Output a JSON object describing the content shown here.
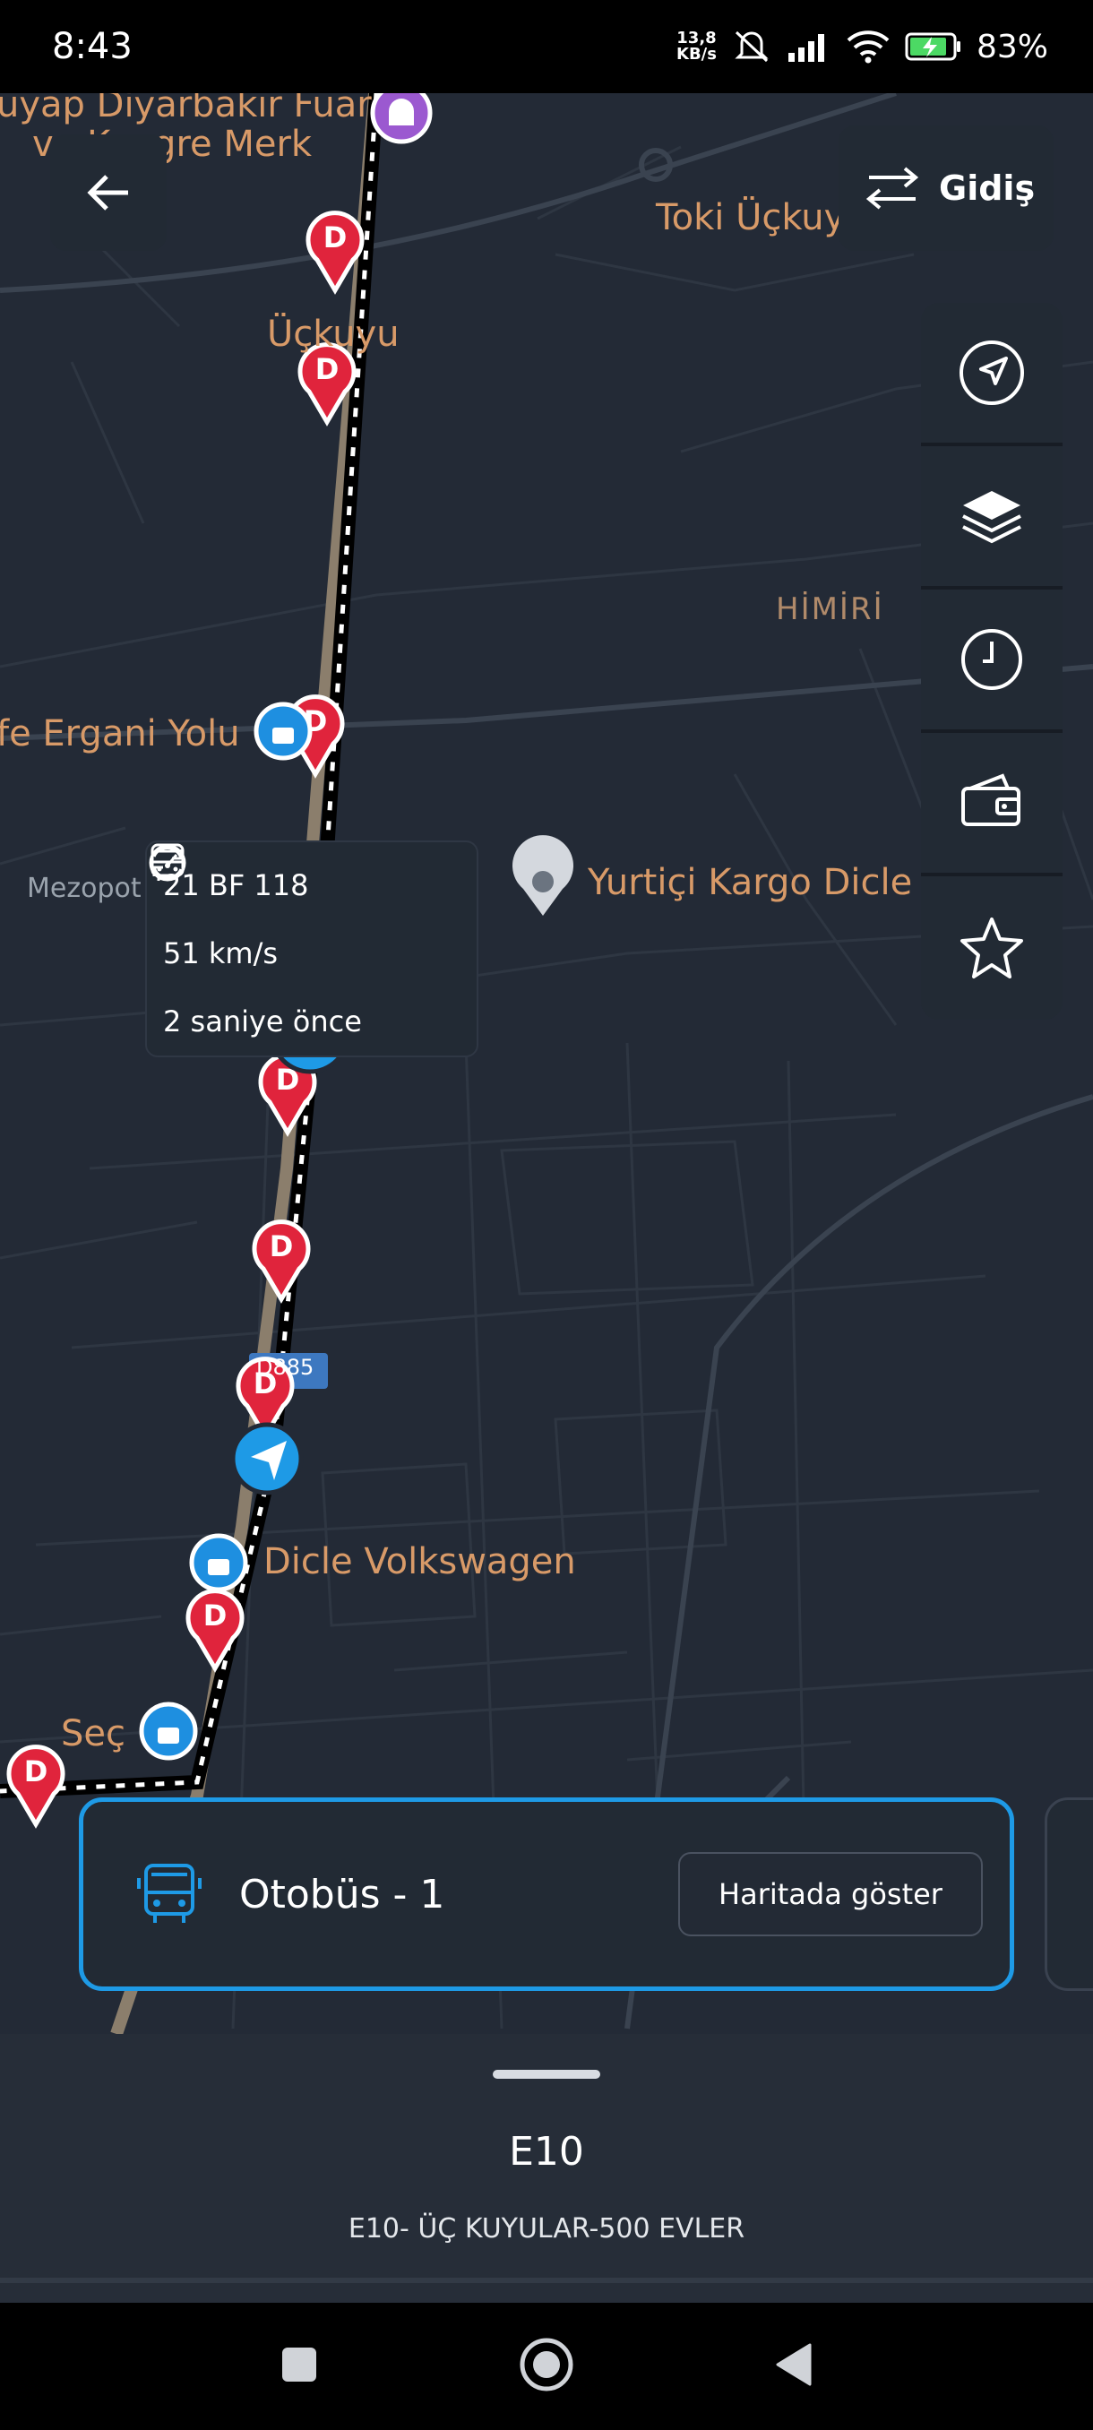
{
  "status_bar": {
    "time": "8:43",
    "net_speed_value": "13,8",
    "net_speed_unit": "KB/s",
    "battery_percent": "83%"
  },
  "map": {
    "labels": {
      "fair": "uyap Diyarbakır Fuar",
      "congress": "ve Kongre Merk",
      "toki": "Toki Üçkuyu",
      "uckuyu": "Üçkuyu",
      "himiri": "HİMİRİ",
      "ergani": "fe Ergani Yolu",
      "mezopot": "Mezopot",
      "yurtici": "Yurtiçi Kargo Dicle",
      "road": "D885",
      "volkswagen": "Dicle Volkswagen",
      "sec": "Seç"
    },
    "stop_letter": "D"
  },
  "direction_button": {
    "label": "Gidiş"
  },
  "toolbar": {
    "items": [
      "navigate-icon",
      "layers-icon",
      "clock-icon",
      "wallet-icon",
      "star-icon"
    ]
  },
  "vehicle_popup": {
    "plate": "21 BF 118",
    "speed": "51 km/s",
    "last_update": "2 saniye önce"
  },
  "bus_card": {
    "title": "Otobüs - 1",
    "show_on_map_label": "Haritada göster"
  },
  "route": {
    "code": "E10",
    "name": "E10- ÜÇ KUYULAR-500 EVLER"
  },
  "colors": {
    "accent": "#1e9ae6",
    "stop_red": "#e0243c",
    "map_label": "#d89a68",
    "map_bg": "#232a36"
  }
}
